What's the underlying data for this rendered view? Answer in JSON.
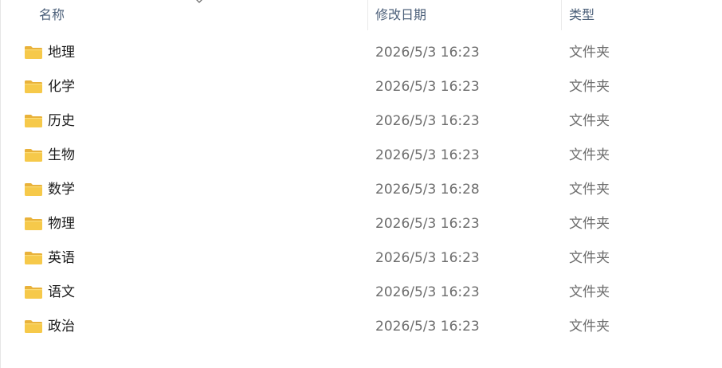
{
  "columns": {
    "name": "名称",
    "modified": "修改日期",
    "type": "类型"
  },
  "items": [
    {
      "name": "地理",
      "modified": "2026/5/3 16:23",
      "type": "文件夹"
    },
    {
      "name": "化学",
      "modified": "2026/5/3 16:23",
      "type": "文件夹"
    },
    {
      "name": "历史",
      "modified": "2026/5/3 16:23",
      "type": "文件夹"
    },
    {
      "name": "生物",
      "modified": "2026/5/3 16:23",
      "type": "文件夹"
    },
    {
      "name": "数学",
      "modified": "2026/5/3 16:28",
      "type": "文件夹"
    },
    {
      "name": "物理",
      "modified": "2026/5/3 16:23",
      "type": "文件夹"
    },
    {
      "name": "英语",
      "modified": "2026/5/3 16:23",
      "type": "文件夹"
    },
    {
      "name": "语文",
      "modified": "2026/5/3 16:23",
      "type": "文件夹"
    },
    {
      "name": "政治",
      "modified": "2026/5/3 16:23",
      "type": "文件夹"
    }
  ],
  "icons": {
    "folder": "folder-icon",
    "sort": "sort-caret-icon"
  },
  "colors": {
    "folder_body": "#f6c94a",
    "folder_tab": "#e9b23a",
    "header_text": "#4c607a",
    "name_text": "#1b1b1b",
    "detail_text": "#6d6d6d"
  }
}
